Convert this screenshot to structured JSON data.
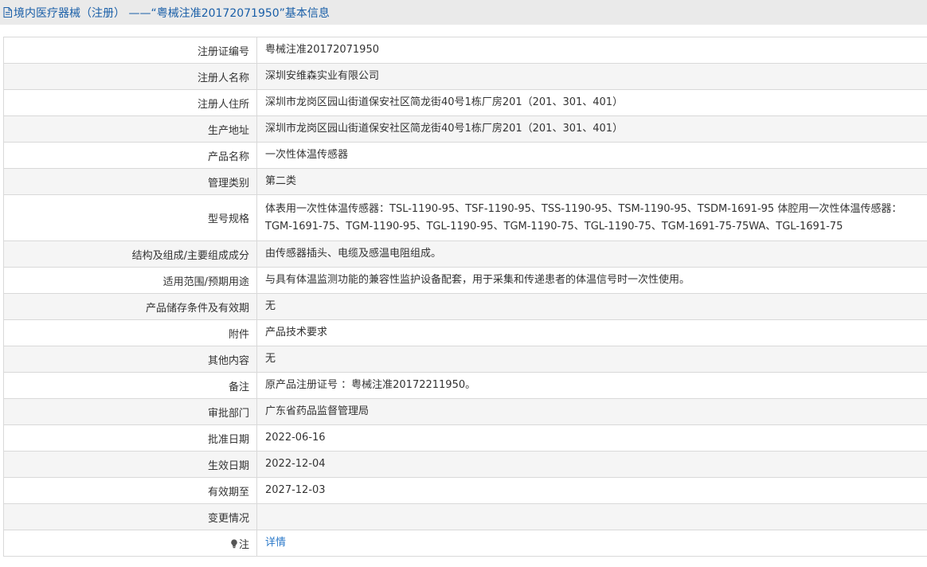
{
  "header": {
    "icon": "document-icon",
    "title": "境内医疗器械（注册） ——“粤械注准20172071950”基本信息"
  },
  "rows": [
    {
      "label": "注册证编号",
      "value": "粤械注准20172071950"
    },
    {
      "label": "注册人名称",
      "value": "深圳安维森实业有限公司"
    },
    {
      "label": "注册人住所",
      "value": "深圳市龙岗区园山街道保安社区简龙街40号1栋厂房201（201、301、401）"
    },
    {
      "label": "生产地址",
      "value": "深圳市龙岗区园山街道保安社区简龙街40号1栋厂房201（201、301、401）"
    },
    {
      "label": "产品名称",
      "value": "一次性体温传感器"
    },
    {
      "label": "管理类别",
      "value": "第二类"
    },
    {
      "label": "型号规格",
      "value": "体表用一次性体温传感器：TSL-1190-95、TSF-1190-95、TSS-1190-95、TSM-1190-95、TSDM-1691-95 体腔用一次性体温传感器：TGM-1691-75、TGM-1190-95、TGL-1190-95、TGM-1190-75、TGL-1190-75、TGM-1691-75-75WA、TGL-1691-75"
    },
    {
      "label": "结构及组成/主要组成成分",
      "value": "由传感器插头、电缆及感温电阻组成。"
    },
    {
      "label": "适用范围/预期用途",
      "value": "与具有体温监测功能的兼容性监护设备配套，用于采集和传递患者的体温信号时一次性使用。"
    },
    {
      "label": "产品储存条件及有效期",
      "value": "无"
    },
    {
      "label": "附件",
      "value": "产品技术要求"
    },
    {
      "label": "其他内容",
      "value": "无"
    },
    {
      "label": "备注",
      "value": "原产品注册证号 ：粤械注准20172211950。"
    },
    {
      "label": "审批部门",
      "value": "广东省药品监督管理局"
    },
    {
      "label": "批准日期",
      "value": "2022-06-16"
    },
    {
      "label": "生效日期",
      "value": "2022-12-04"
    },
    {
      "label": "有效期至",
      "value": "2027-12-03"
    },
    {
      "label": "变更情况",
      "value": ""
    }
  ],
  "note_row": {
    "icon": "lightbulb-icon",
    "label": "注",
    "link": "详情"
  },
  "colors": {
    "header_bg": "#eaeaea",
    "header_text": "#1a5fa8",
    "border": "#d9d9d9",
    "row_alt": "#f5f5f5",
    "link": "#2b79c9"
  }
}
